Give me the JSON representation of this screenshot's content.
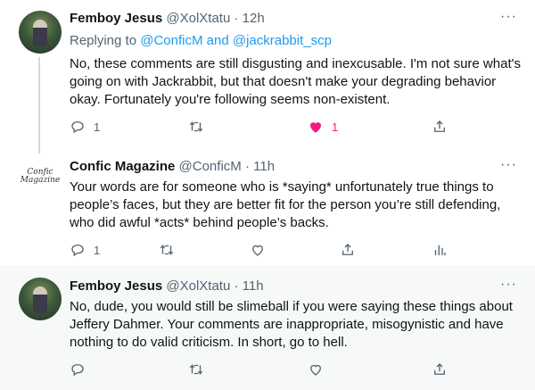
{
  "tweets": [
    {
      "author": "Femboy Jesus",
      "handle": "@XolXtatu",
      "time": "12h",
      "replying_prefix": "Replying to",
      "replying_to_1": "@ConficM",
      "replying_and": "and",
      "replying_to_2": "@jackrabbit_scp",
      "body": "No, these comments are still disgusting and inexcusable. I'm not sure what's going on with Jackrabbit, but that doesn't make your degrading behavior okay. Fortunately you're following seems non-existent.",
      "replies": "1",
      "likes": "1"
    },
    {
      "author": "Confic Magazine",
      "handle": "@ConficM",
      "time": "11h",
      "avatar_text_1": "Confic",
      "avatar_text_2": "Magazine",
      "body": "Your words are for someone who is *saying* unfortunately true things to people’s faces, but they are better fit for the person you’re still defending, who did awful *acts* behind people’s backs.",
      "replies": "1"
    },
    {
      "author": "Femboy Jesus",
      "handle": "@XolXtatu",
      "time": "11h",
      "body": "No, dude, you would still be slimeball if you were saying these things about Jeffery Dahmer. Your comments are inappropriate, misogynistic and have nothing to do valid criticism. In short, go to hell."
    }
  ],
  "separator": "·",
  "more_glyph": "···",
  "colors": {
    "like": "#f91880",
    "link": "#1d9bf0",
    "muted": "#536471"
  }
}
